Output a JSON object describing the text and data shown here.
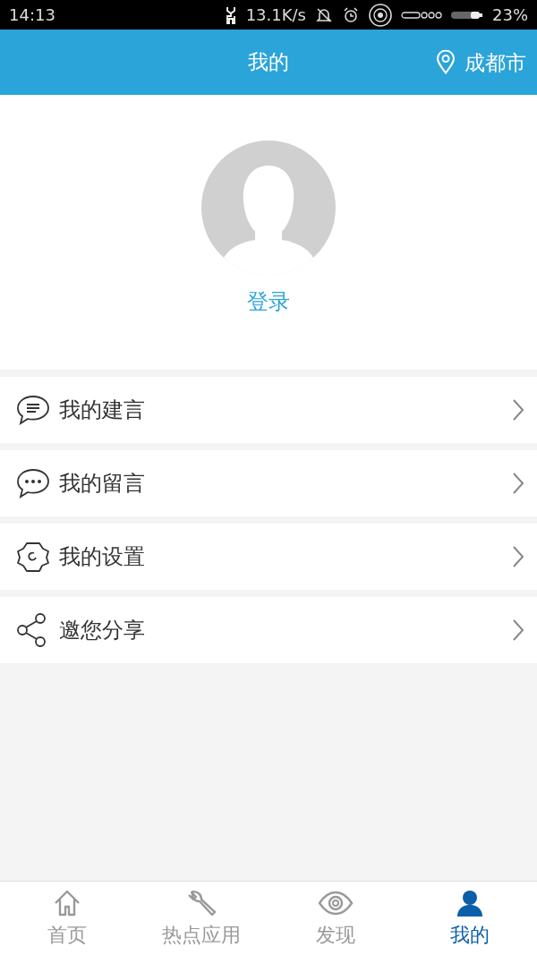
{
  "status_bar": {
    "time": "14:13",
    "speed": "13.1K/s",
    "battery": "23%"
  },
  "header": {
    "title": "我的",
    "location": "成都市"
  },
  "profile": {
    "login": "登录"
  },
  "menu": [
    {
      "kind": "suggestion",
      "label": "我的建言"
    },
    {
      "kind": "message",
      "label": "我的留言"
    },
    {
      "kind": "settings",
      "label": "我的设置"
    },
    {
      "kind": "share",
      "label": "邀您分享"
    }
  ],
  "tabs": [
    {
      "kind": "home",
      "label": "首页",
      "selected": false
    },
    {
      "kind": "apps",
      "label": "热点应用",
      "selected": false
    },
    {
      "kind": "discover",
      "label": "发现",
      "selected": false
    },
    {
      "kind": "me",
      "label": "我的",
      "selected": true
    }
  ]
}
